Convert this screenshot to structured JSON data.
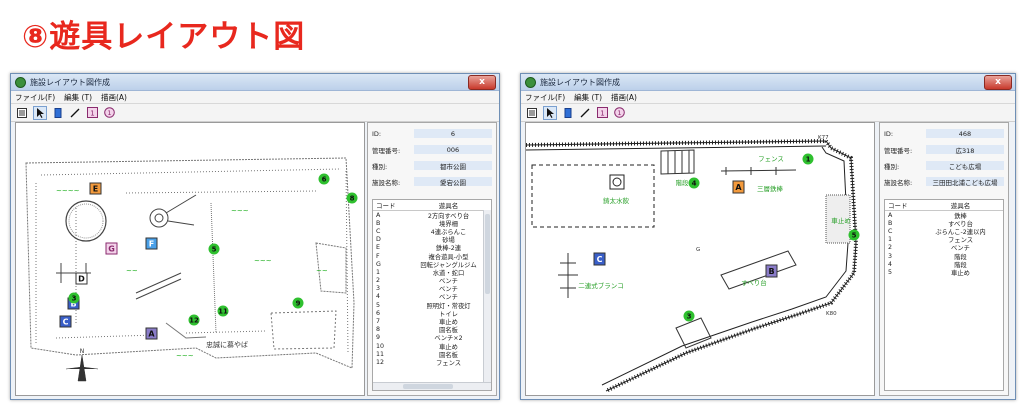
{
  "page_title": "⑧遊具レイアウト図",
  "colors": {
    "title_red": "#e8281e",
    "marker_green": "#2fc02f",
    "label_green": "#1faf1f",
    "orange": "#f39a3c",
    "blue": "#3a5fc8",
    "purple": "#8a7cc9"
  },
  "windows": [
    {
      "title": "施設レイアウト図作成",
      "close_label": "x",
      "menus": [
        "ファイル(F)",
        "編集 (T)",
        "描画(A)"
      ],
      "toolbar_icons": [
        "list-icon",
        "pointer-icon",
        "rect-icon",
        "line-icon",
        "numbered-box-icon",
        "numbered-circle-icon"
      ],
      "info": [
        {
          "label": "ID:",
          "value": "6"
        },
        {
          "label": "管理番号:",
          "value": "006"
        },
        {
          "label": "種別:",
          "value": "都市公園"
        },
        {
          "label": "施設名称:",
          "value": "愛宕公園"
        }
      ],
      "list_header": {
        "code": "コード",
        "name": "遊具名"
      },
      "list": [
        {
          "code": "A",
          "name": "2方向すべり台"
        },
        {
          "code": "B",
          "name": "境界柵"
        },
        {
          "code": "C",
          "name": "4連ぶらんこ"
        },
        {
          "code": "D",
          "name": "砂場"
        },
        {
          "code": "E",
          "name": "鉄棒-2連"
        },
        {
          "code": "F",
          "name": "複合遊具-小型"
        },
        {
          "code": "G",
          "name": "回転ジャングルジム"
        },
        {
          "code": "1",
          "name": "水道・蛇口"
        },
        {
          "code": "2",
          "name": "ベンチ"
        },
        {
          "code": "3",
          "name": "ベンチ"
        },
        {
          "code": "4",
          "name": "ベンチ"
        },
        {
          "code": "5",
          "name": "照明灯・常夜灯"
        },
        {
          "code": "6",
          "name": "トイレ"
        },
        {
          "code": "7",
          "name": "車止め"
        },
        {
          "code": "8",
          "name": "園名板"
        },
        {
          "code": "9",
          "name": "ベンチ×2"
        },
        {
          "code": "10",
          "name": "車止め"
        },
        {
          "code": "11",
          "name": "園名板"
        },
        {
          "code": "12",
          "name": "フェンス"
        }
      ],
      "map_labels": {
        "bottom_text": "忠誠に慕やば",
        "compass": "N"
      },
      "markers_letters": [
        "A",
        "B",
        "C",
        "D",
        "E",
        "F",
        "G"
      ],
      "markers_numbers": [
        "3",
        "5",
        "6",
        "8",
        "9",
        "11",
        "12"
      ]
    },
    {
      "title": "施設レイアウト図作成",
      "close_label": "x",
      "menus": [
        "ファイル(F)",
        "編集 (T)",
        "描画(A)"
      ],
      "toolbar_icons": [
        "list-icon",
        "pointer-icon",
        "rect-icon",
        "line-icon",
        "numbered-box-icon",
        "numbered-circle-icon"
      ],
      "info": [
        {
          "label": "ID:",
          "value": "468"
        },
        {
          "label": "管理番号:",
          "value": "広318"
        },
        {
          "label": "種別:",
          "value": "こども広場"
        },
        {
          "label": "施設名称:",
          "value": "三田田北浦こども広場"
        }
      ],
      "list_header": {
        "code": "コード",
        "name": "遊具名"
      },
      "list": [
        {
          "code": "A",
          "name": "鉄棒"
        },
        {
          "code": "B",
          "name": "すべり台"
        },
        {
          "code": "C",
          "name": "ぶらんこ-2連以内"
        },
        {
          "code": "1",
          "name": "フェンス"
        },
        {
          "code": "2",
          "name": "ベンチ"
        },
        {
          "code": "3",
          "name": "階段"
        },
        {
          "code": "4",
          "name": "階段"
        },
        {
          "code": "5",
          "name": "車止め"
        }
      ],
      "map_labels": {
        "fence": "フェンス",
        "water": "鋳太水飲",
        "stairs": "階段",
        "iron_bar": "三層鉄棒",
        "slide": "すべり台",
        "swing": "二連式ブランコ",
        "car_stop": "車止め",
        "k77": "K77",
        "k80": "K80",
        "g": "G"
      }
    }
  ]
}
